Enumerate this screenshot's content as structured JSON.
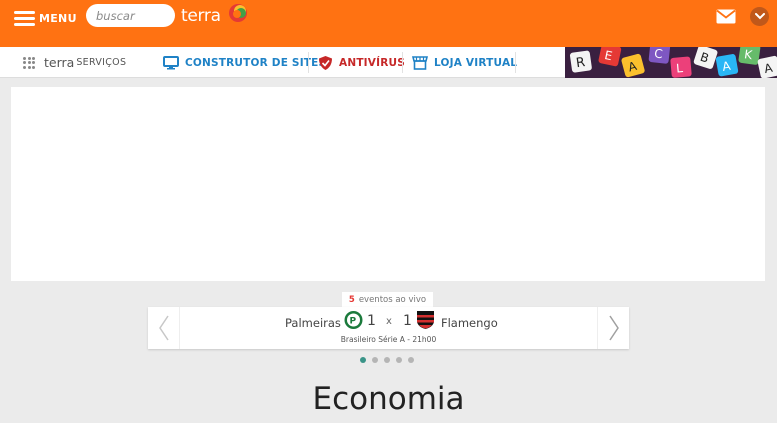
{
  "header": {
    "menu_label": "MENU",
    "search_placeholder": "buscar",
    "logo_text": "terra",
    "brand_color": "#ff7212",
    "icons": [
      "hamburger-icon",
      "terra-logo-mark",
      "mail-icon",
      "chevron-down-icon"
    ]
  },
  "services": {
    "brand_terra": "terra",
    "brand_servicos": "SERVIÇOS",
    "items": [
      {
        "label": "CONSTRUTOR DE SITES",
        "icon": "monitor-icon",
        "color": "#1f82c6"
      },
      {
        "label": "ANTIVÍRUS",
        "icon": "shield-icon",
        "color": "#c62828"
      },
      {
        "label": "LOJA VIRTUAL",
        "icon": "store-icon",
        "color": "#1f82c6"
      }
    ]
  },
  "live": {
    "count": "5",
    "label": "eventos ao vivo",
    "match": {
      "home_team": "Palmeiras",
      "home_score": "1",
      "separator": "x",
      "away_score": "1",
      "away_team": "Flamengo",
      "league": "Brasileiro Série A - 21h00"
    },
    "dots_total": 5,
    "active_dot": 0
  },
  "section": {
    "title": "Economia"
  }
}
